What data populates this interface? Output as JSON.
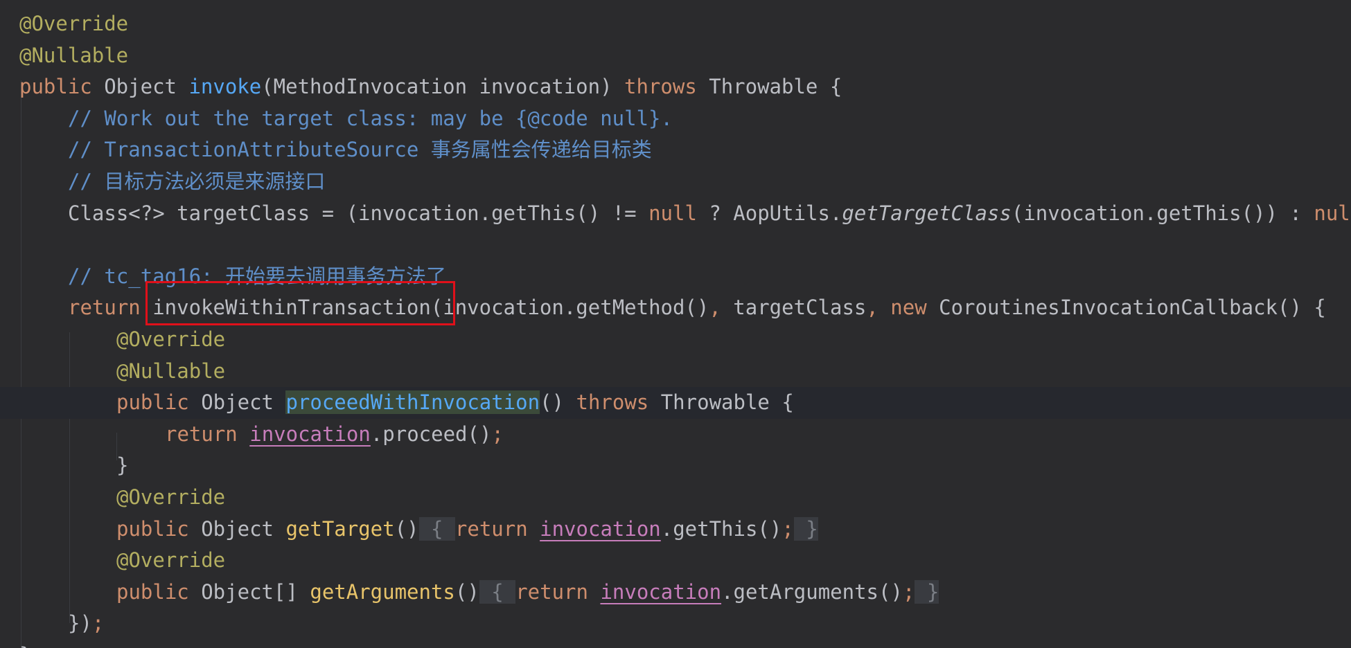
{
  "colors": {
    "background": "#2b2b2d",
    "annotation": "#b3ae60",
    "keyword": "#cf8e6d",
    "method_declaration": "#56a8f5",
    "comment": "#5f8fc9",
    "field": "#c77dbb",
    "plain": "#bcbec4",
    "highlight_box": "#e0101a"
  },
  "code": {
    "l1_ann": "@Override",
    "l2_ann": "@Nullable",
    "l3_public": "public",
    "l3_type": " Object ",
    "l3_name": "invoke",
    "l3_params": "(MethodInvocation invocation) ",
    "l3_throws": "throws",
    "l3_tail": " Throwable {",
    "l4_comment": "// Work out the target class: may be {@code null}.",
    "l5_comment": "// TransactionAttributeSource 事务属性会传递给目标类",
    "l6_comment": "// 目标方法必须是来源接口",
    "l7_a": "Class<?> targetClass = (invocation.getThis() != ",
    "l7_null": "null",
    "l7_b": " ? AopUtils.",
    "l7_italic": "getTargetClass",
    "l7_c": "(invocation.getThis()) : ",
    "l7_null2": "null",
    "l9_comment": "// tc_tag16: 开始要去调用事务方法了",
    "l10_return": "return",
    "l10_call": " invokeWithinTransaction",
    "l10_args": "(invocation.getMethod()",
    "l10_comma1": ",",
    "l10_mid": " targetClass",
    "l10_comma2": ",",
    "l10_new": " new",
    "l10_tail": " CoroutinesInvocationCallback() {",
    "l11_ann": "@Override",
    "l12_ann": "@Nullable",
    "l13_public": "public",
    "l13_type": " Object ",
    "l13_name": "proceedWithInvocation",
    "l13_parens": "() ",
    "l13_throws": "throws",
    "l13_tail": " Throwable {",
    "l14_return": "return",
    "l14_field": "invocation",
    "l14_tail": ".proceed()",
    "l14_semi": ";",
    "l15_close": "}",
    "l16_ann": "@Override",
    "l17_public": "public",
    "l17_type": " Object ",
    "l17_name": "getTarget",
    "l17_parens": "()",
    "l17_fold_open": " { ",
    "l17_return": "return",
    "l17_field": "invocation",
    "l17_tail": ".getThis()",
    "l17_semi": ";",
    "l17_fold_close": " }",
    "l18_ann": "@Override",
    "l19_public": "public",
    "l19_type": " Object[] ",
    "l19_name": "getArguments",
    "l19_parens": "()",
    "l19_fold_open": " { ",
    "l19_return": "return",
    "l19_field": "invocation",
    "l19_tail": ".getArguments()",
    "l19_semi": ";",
    "l19_fold_close": " }",
    "l20_close": "})",
    "l20_semi": ";",
    "l21_close": "}"
  }
}
